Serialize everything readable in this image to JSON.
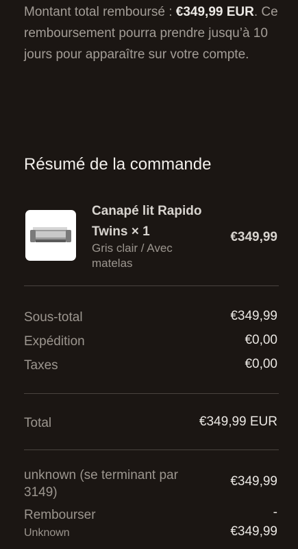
{
  "refund": {
    "prefix": "Montant total remboursé : ",
    "amount": "€349,99 EUR",
    "suffix": ". Ce remboursement pourra prendre jusqu’à 10 jours pour apparaître sur votre compte."
  },
  "summary": {
    "title": "Résumé de la commande",
    "product": {
      "name": "Canapé lit Rapido Twins × 1",
      "variant": "Gris clair / Avec matelas",
      "price": "€349,99",
      "image_icon": "sofa-bed-product-image"
    },
    "subtotal": {
      "label": "Sous-total",
      "value": "€349,99"
    },
    "shipping": {
      "label": "Expédition",
      "value": "€0,00"
    },
    "taxes": {
      "label": "Taxes",
      "value": "€0,00"
    },
    "total": {
      "label": "Total",
      "value": "€349,99 EUR"
    },
    "payment": {
      "label": "unknown (se terminant par 3149)",
      "value": "€349,99"
    },
    "refund_row": {
      "label": "Rembourser",
      "value": "-",
      "method": "Unknown",
      "amount": "€349,99"
    }
  },
  "colors": {
    "background": "#1b1613",
    "text": "#e9e6e2",
    "muted": "#9c968f",
    "divider": "#4a4440"
  }
}
